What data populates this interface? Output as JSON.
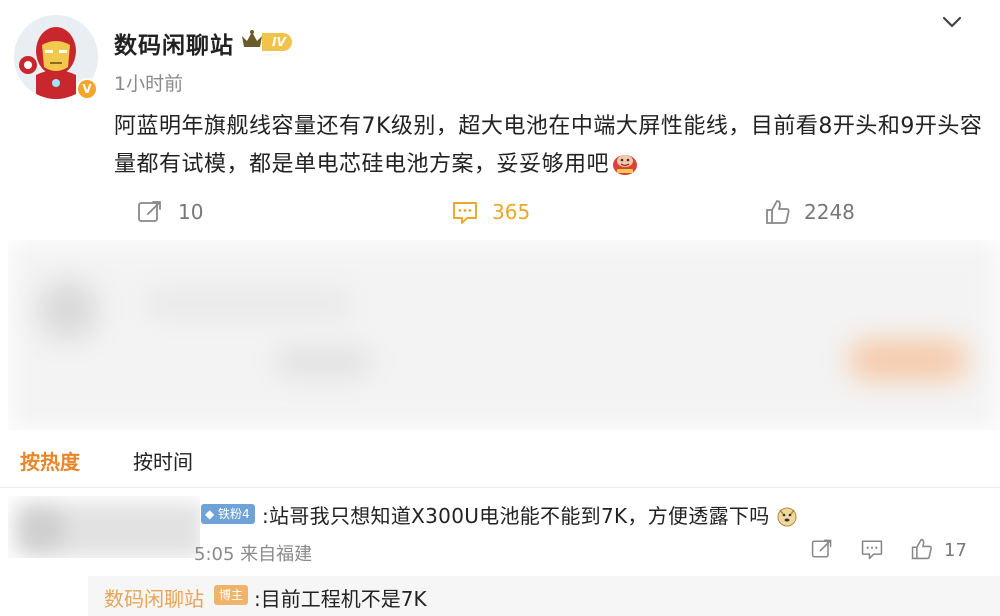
{
  "post": {
    "username": "数码闲聊站",
    "level_badge": "IV",
    "time": "1小时前",
    "text": "阿蓝明年旗舰线容量还有7K级别，超大电池在中端大屏性能线，目前看8开头和9开头容量都有试模，都是单电芯硅电池方案，妥妥够用吧",
    "emoji_icon": "awesome-emoji",
    "actions": {
      "reposts": "10",
      "comments": "365",
      "likes": "2248"
    },
    "colors": {
      "accent": "#e8a82a",
      "username_orange": "#e8a458"
    }
  },
  "sort": {
    "hot": "按热度",
    "time": "按时间"
  },
  "comment": {
    "fan_badge": "铁粉4",
    "text": ":站哥我只想知道X300U电池能不能到7K，方便透露下吗",
    "meta": "5:05 来自福建",
    "likes": "17"
  },
  "reply": {
    "username": "数码闲聊站",
    "badge": "博主",
    "text": ":目前工程机不是7K"
  }
}
